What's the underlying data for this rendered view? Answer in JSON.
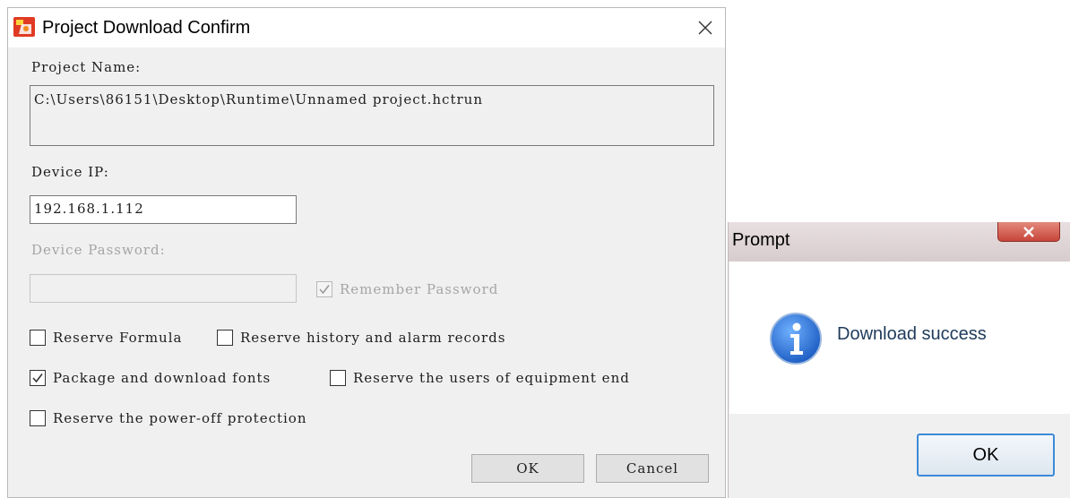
{
  "confirm_dialog": {
    "title": "Project Download Confirm",
    "project_name_label": "Project Name:",
    "project_name_value": "C:\\Users\\86151\\Desktop\\Runtime\\Unnamed project.hctrun",
    "device_ip_label": "Device IP:",
    "device_ip_value": "192.168.1.112",
    "device_password_label": "Device Password:",
    "device_password_value": "",
    "remember_password": {
      "label": "Remember Password",
      "checked": true,
      "enabled": false
    },
    "options": [
      {
        "label": "Reserve Formula",
        "checked": false
      },
      {
        "label": "Reserve history and alarm records",
        "checked": false
      },
      {
        "label": "Package and download fonts",
        "checked": true
      },
      {
        "label": "Reserve the users of equipment end",
        "checked": false
      },
      {
        "label": "Reserve the power-off protection",
        "checked": false
      }
    ],
    "ok_label": "OK",
    "cancel_label": "Cancel"
  },
  "prompt_dialog": {
    "title": "Prompt",
    "message": "Download success",
    "ok_label": "OK"
  },
  "colors": {
    "dialog_bg": "#f0f0f0",
    "prompt_close": "#c8453a",
    "info_icon": "#1f5fc4",
    "ok_focus_border": "#3c8ad8"
  }
}
